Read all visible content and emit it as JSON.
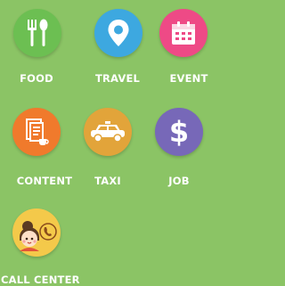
{
  "tiles": [
    {
      "label": "FOOD",
      "icon": "fork-spoon-icon",
      "color": "#6cbf52"
    },
    {
      "label": "TRAVEL",
      "icon": "map-pin-icon",
      "color": "#3da8e0"
    },
    {
      "label": "EVENT",
      "icon": "calendar-icon",
      "color": "#ee4a86"
    },
    {
      "label": "CONTENT",
      "icon": "document-icon",
      "color": "#f07a2c"
    },
    {
      "label": "TAXI",
      "icon": "taxi-icon",
      "color": "#e2a43a"
    },
    {
      "label": "JOB",
      "icon": "dollar-icon",
      "color": "#7768b8"
    },
    {
      "label": "CALL CENTER",
      "icon": "call-center-icon",
      "color": "#f4c94a"
    }
  ]
}
